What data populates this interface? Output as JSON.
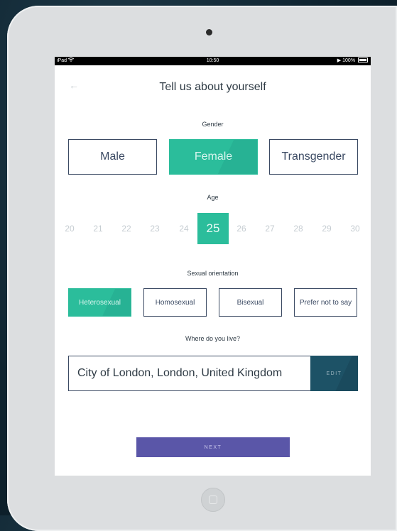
{
  "status_bar": {
    "device": "iPad",
    "time": "10:50",
    "battery": "100%"
  },
  "header": {
    "title": "Tell us about yourself"
  },
  "gender": {
    "label": "Gender",
    "options": [
      "Male",
      "Female",
      "Transgender"
    ],
    "selected": "Female"
  },
  "age": {
    "label": "Age",
    "options": [
      "20",
      "21",
      "22",
      "23",
      "24",
      "25",
      "26",
      "27",
      "28",
      "29",
      "30"
    ],
    "selected": "25"
  },
  "orientation": {
    "label": "Sexual orientation",
    "options": [
      "Heterosexual",
      "Homosexual",
      "Bisexual",
      "Prefer not to say"
    ],
    "selected": "Heterosexual"
  },
  "location": {
    "label": "Where do you live?",
    "value": "City of London, London, United Kingdom",
    "edit_label": "EDIT"
  },
  "next_label": "NEXT",
  "colors": {
    "accent": "#2bbd9b",
    "dark_teal": "#1d5266",
    "primary": "#5a56a8",
    "outline": "#3b4a63"
  },
  "icons": {
    "back": "arrow-left-icon",
    "wifi": "wifi-icon",
    "battery": "battery-icon",
    "home": "home-button-icon"
  }
}
